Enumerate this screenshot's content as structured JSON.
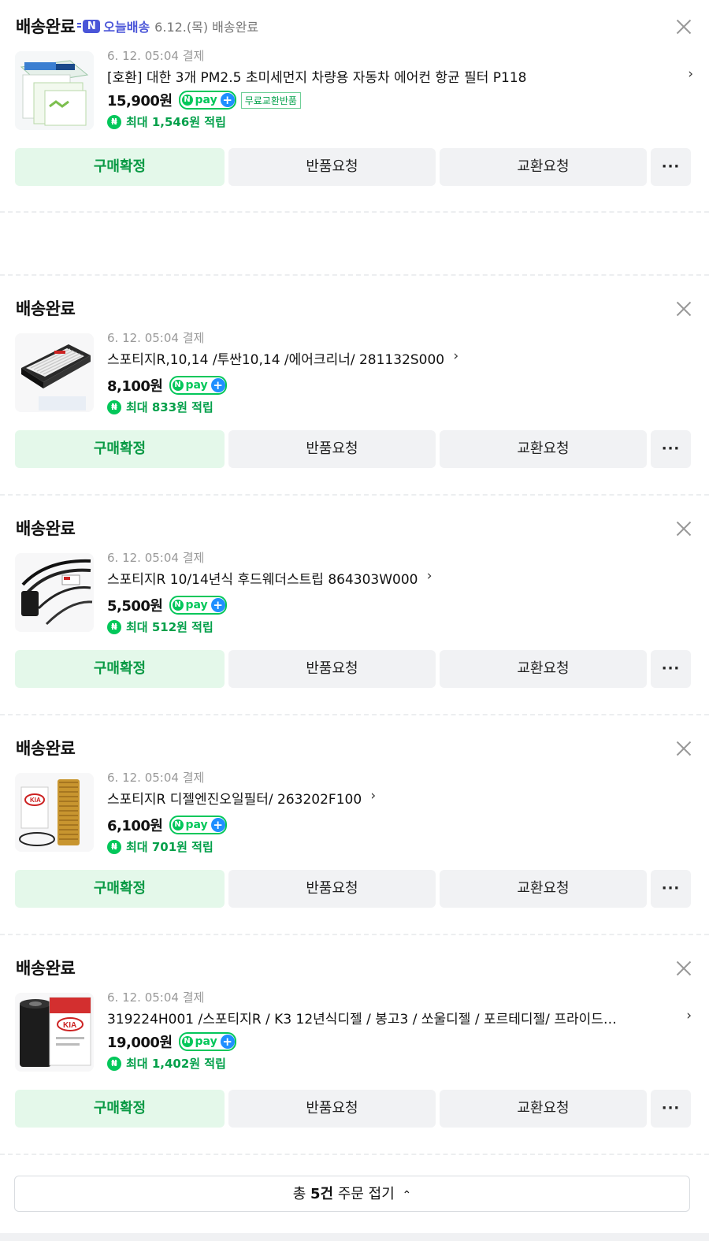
{
  "orders": [
    {
      "status": "배송완료",
      "badge": "오늘배송",
      "date_note": "6.12.(목) 배송완료",
      "pay_date": "6. 12. 05:04 결제",
      "name": "[호환] 대한 3개 PM2.5 초미세먼지 차량용 자동차 에어컨 항균 필터 P118",
      "price": "15,900원",
      "free_badge": "무료교환반품",
      "points": "최대 1,546원 적립",
      "thumb": "cabin-air-filter"
    },
    {
      "status": "배송완료",
      "pay_date": "6. 12. 05:04 결제",
      "name": "스포티지R,10,14 /투싼10,14 /에어크리너/ 281132S000",
      "price": "8,100원",
      "points": "최대 833원 적립",
      "thumb": "air-cleaner"
    },
    {
      "status": "배송완료",
      "pay_date": "6. 12. 05:04 결제",
      "name": "스포티지R 10/14년식 후드웨더스트립 864303W000",
      "price": "5,500원",
      "points": "최대 512원 적립",
      "thumb": "weatherstrip"
    },
    {
      "status": "배송완료",
      "pay_date": "6. 12. 05:04 결제",
      "name": "스포티지R 디젤엔진오일필터/ 263202F100",
      "price": "6,100원",
      "points": "최대 701원 적립",
      "thumb": "oil-filter"
    },
    {
      "status": "배송완료",
      "pay_date": "6. 12. 05:04 결제",
      "name": "319224H001 /스포티지R / K3 12년식디젤 / 봉고3 / 쏘울디젤 / 포르테디젤/ 프라이드…",
      "price": "19,000원",
      "points": "최대 1,402원 적립",
      "thumb": "fuel-filter"
    }
  ],
  "buttons": {
    "confirm": "구매확정",
    "return": "반품요청",
    "exchange": "교환요청",
    "more": "···"
  },
  "npay": {
    "n": "N",
    "text": "pay",
    "plus": "+"
  },
  "chevron": "›",
  "collapse": {
    "prefix": "총 ",
    "count": "5건",
    "suffix": " 주문 접기",
    "icon": "⌃"
  }
}
